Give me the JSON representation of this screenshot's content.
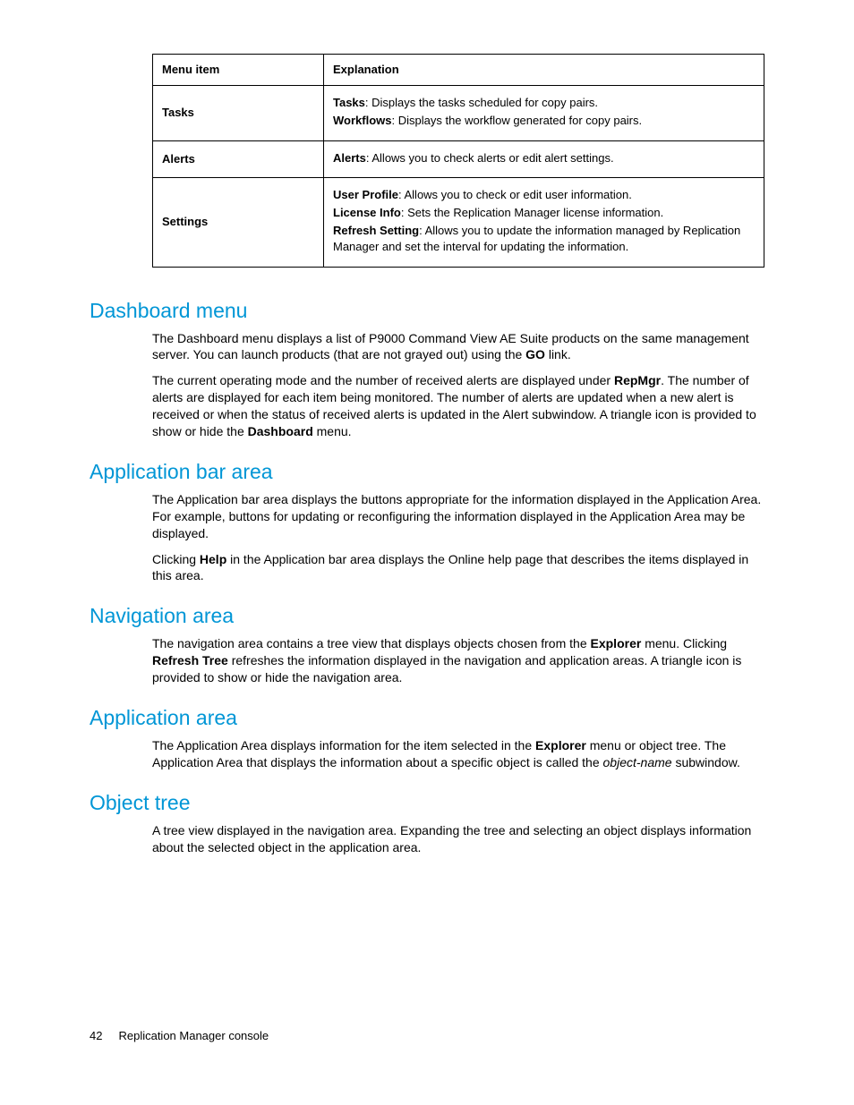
{
  "table": {
    "headers": {
      "menu": "Menu item",
      "expl": "Explanation"
    },
    "rows": [
      {
        "menu": "Tasks",
        "lines": [
          {
            "b": "Tasks",
            "t": ": Displays the tasks scheduled for copy pairs."
          },
          {
            "b": "Workflows",
            "t": ": Displays the workflow generated for copy pairs."
          }
        ]
      },
      {
        "menu": "Alerts",
        "lines": [
          {
            "b": "Alerts",
            "t": ": Allows you to check alerts or edit alert settings."
          }
        ]
      },
      {
        "menu": "Settings",
        "lines": [
          {
            "b": "User Profile",
            "t": ": Allows you to check or edit user information."
          },
          {
            "b": "License Info",
            "t": ": Sets the Replication Manager license information."
          },
          {
            "b": "Refresh Setting",
            "t": ": Allows you to update the information managed by Replication Manager and set the interval for updating the information."
          }
        ]
      }
    ]
  },
  "sections": {
    "dashboard": {
      "title": "Dashboard menu",
      "p1a": "The Dashboard menu displays a list of P9000 Command View AE Suite products on the same management server.  You can launch products (that are not grayed out) using the ",
      "p1b": "GO",
      "p1c": " link.",
      "p2a": "The current operating mode and the number of received alerts are displayed under ",
      "p2b": "RepMgr",
      "p2c": ". The number of alerts are displayed for each item being monitored. The number of alerts are updated when a new alert is received or when the status of received alerts is updated in the Alert subwindow. A triangle icon is provided to show or hide the ",
      "p2d": "Dashboard",
      "p2e": " menu."
    },
    "appbar": {
      "title": "Application bar area",
      "p1": "The Application bar area displays the buttons appropriate for the information displayed in the Application Area. For example, buttons for updating or reconfiguring the information displayed in the Application Area may be displayed.",
      "p2a": "Clicking ",
      "p2b": "Help",
      "p2c": " in the Application bar area displays the Online help page that describes the items displayed in this area."
    },
    "nav": {
      "title": "Navigation area",
      "p1a": "The navigation area contains a tree view that displays objects chosen from the ",
      "p1b": "Explorer",
      "p1c": " menu. Clicking ",
      "p1d": "Refresh Tree",
      "p1e": " refreshes the information displayed in the navigation and application areas. A triangle icon is provided to show or hide the navigation area."
    },
    "apparea": {
      "title": "Application area",
      "p1a": "The Application Area displays information for the item selected in the ",
      "p1b": "Explorer",
      "p1c": " menu or object tree. The Application Area that displays the information about a specific object is called the ",
      "p1d": "object-name",
      "p1e": " subwindow."
    },
    "objtree": {
      "title": "Object tree",
      "p1": "A tree view displayed in the navigation area.  Expanding the tree and selecting an object displays information about the selected object in the application area."
    }
  },
  "footer": {
    "page": "42",
    "title": "Replication Manager console"
  }
}
